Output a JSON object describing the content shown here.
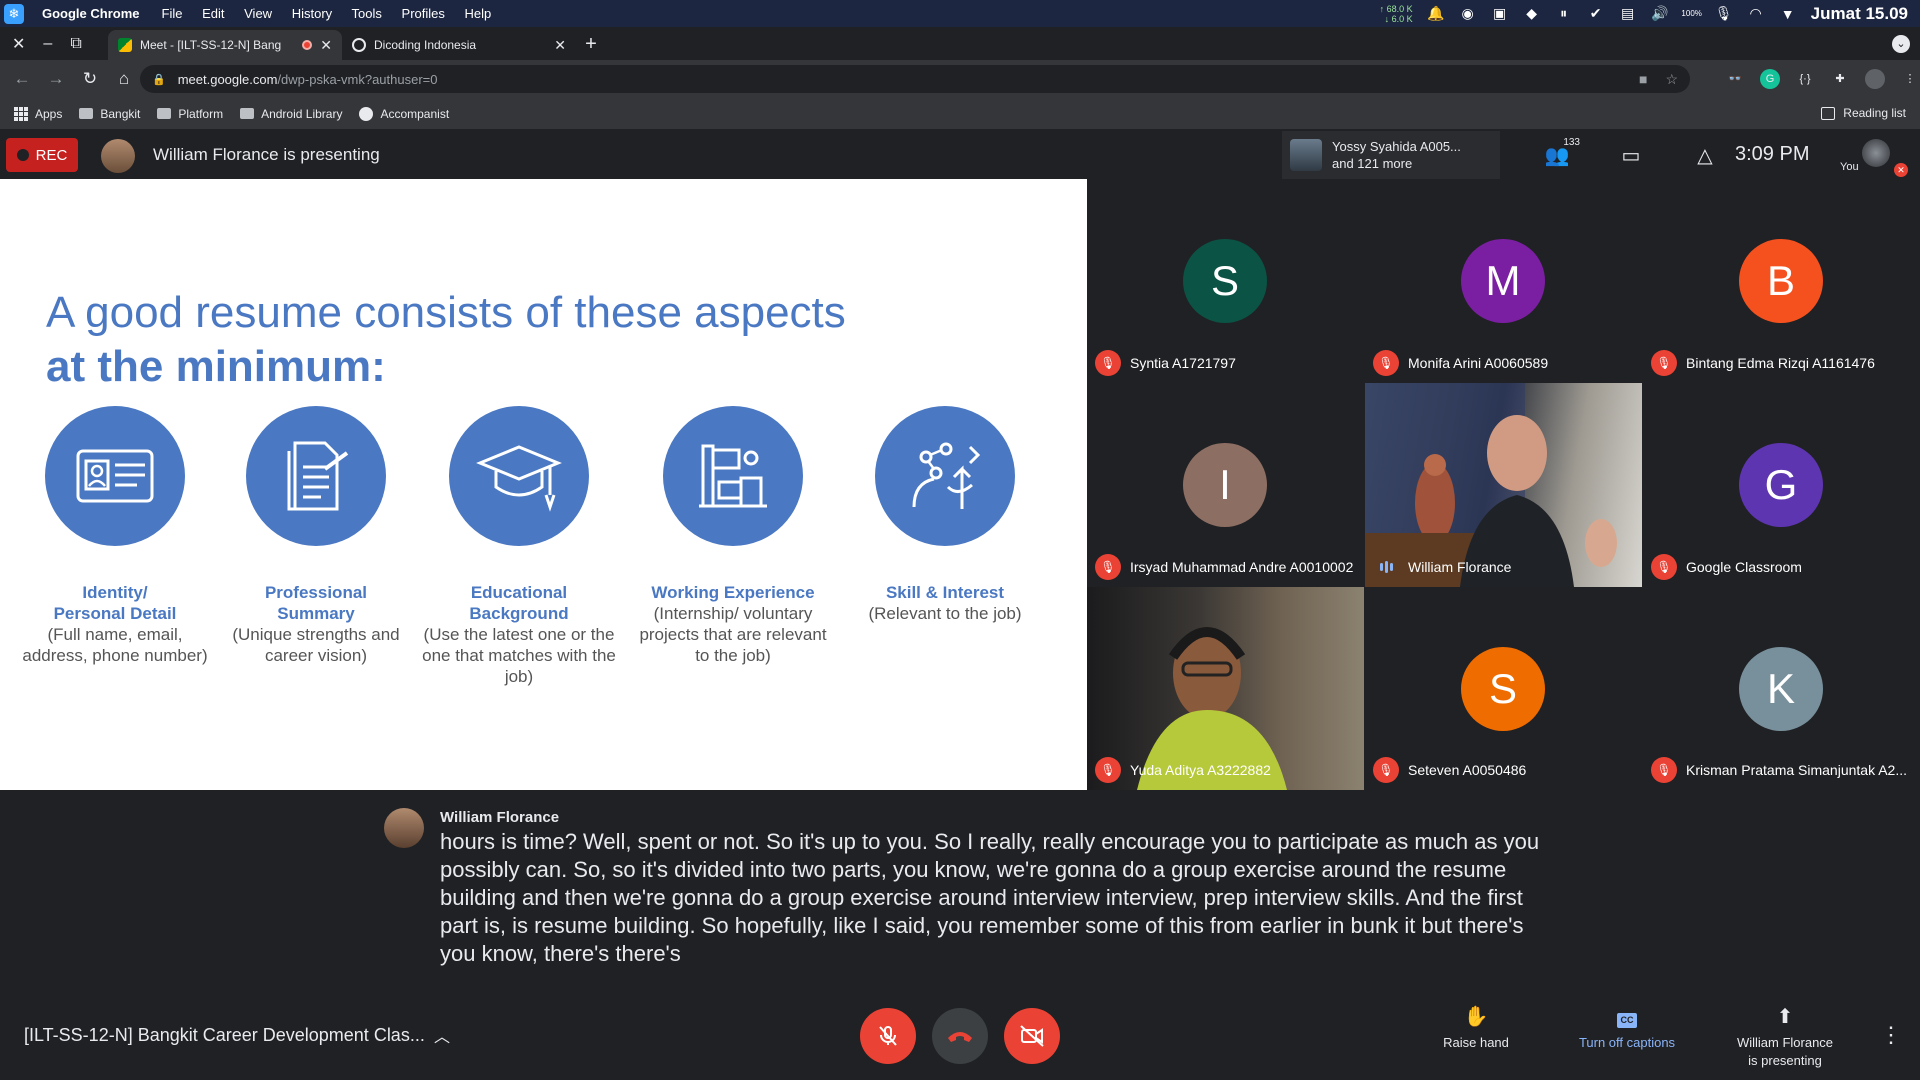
{
  "os": {
    "app_name": "Google Chrome",
    "menu": [
      "File",
      "Edit",
      "View",
      "History",
      "Tools",
      "Profiles",
      "Help"
    ],
    "net_up": "68.0 K",
    "net_down": "6.0 K",
    "battery": "100%",
    "clock": "Jumat 15.09"
  },
  "browser": {
    "tabs": [
      {
        "title": "Meet - [ILT-SS-12-N] Bang",
        "active": true,
        "recording": true
      },
      {
        "title": "Dicoding Indonesia",
        "active": false,
        "recording": false
      }
    ],
    "url_host": "meet.google.com",
    "url_path": "/dwp-pska-vmk?authuser=0",
    "bookmarks": [
      "Apps",
      "Bangkit",
      "Platform",
      "Android Library",
      "Accompanist"
    ],
    "reading_list": "Reading list"
  },
  "meet": {
    "rec_label": "REC",
    "presenting_text": "William Florance is presenting",
    "others_line1": "Yossy Syahida A005...",
    "others_line2": "and 121 more",
    "participant_count": "133",
    "time": "3:09 PM",
    "you_label": "You",
    "slide": {
      "heading_line1": "A good resume consists of these aspects",
      "heading_line2": "at the minimum:",
      "aspects": [
        {
          "title_line1": "Identity/",
          "title_line2": "Personal Detail",
          "desc": "(Full name, email, address, phone number)",
          "icon": "id-card-icon"
        },
        {
          "title_line1": "Professional",
          "title_line2": "Summary",
          "desc": "(Unique strengths and career vision)",
          "icon": "document-icon"
        },
        {
          "title_line1": "Educational",
          "title_line2": "Background",
          "desc": "(Use the latest one or the one that matches with the job)",
          "icon": "graduation-cap-icon"
        },
        {
          "title_line1": "Working Experience",
          "title_line2": "",
          "desc": "(Internship/ voluntary projects that are relevant to the job)",
          "icon": "worker-desk-icon"
        },
        {
          "title_line1": "Skill & Interest",
          "title_line2": "",
          "desc": "(Relevant to the job)",
          "icon": "brain-arrows-icon"
        }
      ]
    },
    "participants": [
      {
        "name": "Syntia A1721797",
        "initial": "S",
        "color": "#0b5345",
        "muted": true
      },
      {
        "name": "Monifa Arini A0060589",
        "initial": "M",
        "color": "#7b1fa2",
        "muted": true
      },
      {
        "name": "Bintang Edma Rizqi A1161476",
        "initial": "B",
        "color": "#f4511e",
        "muted": true
      },
      {
        "name": "Irsyad Muhammad Andre A0010002",
        "initial": "I",
        "color": "#8d6e63",
        "muted": true
      },
      {
        "name": "William Florance",
        "initial": "",
        "color": "",
        "muted": false
      },
      {
        "name": "Google Classroom",
        "initial": "G",
        "color": "#5e35b1",
        "muted": true
      },
      {
        "name": "Yuda Aditya A3222882",
        "initial": "",
        "color": "",
        "muted": true
      },
      {
        "name": "Seteven A0050486",
        "initial": "S",
        "color": "#ef6c00",
        "muted": true
      },
      {
        "name": "Krisman Pratama Simanjuntak A2...",
        "initial": "K",
        "color": "#78909c",
        "muted": true
      }
    ],
    "caption_speaker": "William Florance",
    "caption_text": "hours is time? Well, spent or not. So it's up to you. So I really, really encourage you to participate as much as you possibly can. So, so it's divided into two parts, you know, we're gonna do a group exercise around the resume building and then we're gonna do a group exercise around interview interview, prep interview skills. And the first part is, is resume building. So hopefully, like I said, you remember some of this from earlier in bunk it but there's you know, there's there's",
    "meeting_name": "[ILT-SS-12-N] Bangkit Career Development Clas...",
    "raise_hand": "Raise hand",
    "captions_toggle": "Turn off captions",
    "presenting_line1": "William Florance",
    "presenting_line2": "is presenting"
  }
}
